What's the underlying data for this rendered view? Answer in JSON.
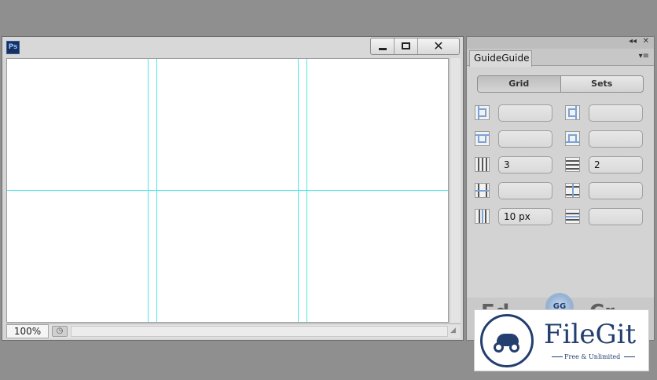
{
  "ps_window": {
    "logo": "Ps",
    "close_glyph": "✕",
    "zoom": "100%",
    "status_icon_glyph": "◷",
    "resize_glyph": "◢"
  },
  "panel": {
    "collapse_glyph": "◂◂",
    "close_glyph": "✕",
    "tab_title": "GuideGuide",
    "menu_glyph": "▾≡",
    "seg_grid": "Grid",
    "seg_sets": "Sets",
    "rows": [
      {
        "left_value": "",
        "right_value": ""
      },
      {
        "left_value": "",
        "right_value": ""
      },
      {
        "left_value": "3",
        "right_value": "2"
      },
      {
        "left_value": "",
        "right_value": ""
      },
      {
        "left_value": "10 px",
        "right_value": ""
      }
    ],
    "badge": "GG",
    "bottom_left_word": "Ed",
    "bottom_right_word": "Cr"
  },
  "watermark": {
    "name": "FileGit",
    "tagline": "Free & Unlimited"
  },
  "colors": {
    "guide": "#4fe7ec",
    "brand": "#233f6f",
    "icon_accent": "#7aa3d6"
  }
}
